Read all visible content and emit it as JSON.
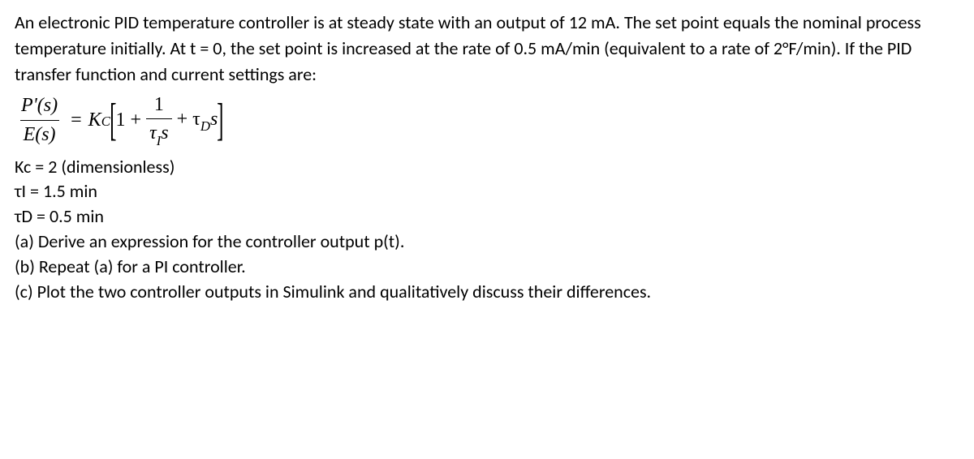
{
  "problem": {
    "intro": "An electronic PID temperature controller is at steady state with an output of 12 mA. The set point equals the nominal process temperature initially. At t = 0, the set point is increased at the rate of 0.5 mA/min (equivalent to a rate of 2°F/min). If the PID transfer function and current settings are:",
    "eq": {
      "lhs_num": "P'(s)",
      "lhs_den": "E(s)",
      "equals": "=",
      "Kc": "K",
      "Kc_sub": "C",
      "lbracket": "[",
      "one_plus": "1 +",
      "inner_num": "1",
      "inner_den_a": "τ",
      "inner_den_sub": "I",
      "inner_den_b": "s",
      "plus2": "+ τ",
      "tauD_sub": "D",
      "s_tail": "s",
      "rbracket": "]"
    },
    "params": {
      "Kc": "Kc = 2 (dimensionless)",
      "tauI": "τI = 1.5 min",
      "tauD": "τD = 0.5 min"
    },
    "parts": {
      "a": "(a) Derive an expression for the controller output p(t).",
      "b": "(b) Repeat (a) for a PI controller.",
      "c": "(c) Plot the two controller outputs in Simulink and qualitatively discuss their differences."
    }
  }
}
